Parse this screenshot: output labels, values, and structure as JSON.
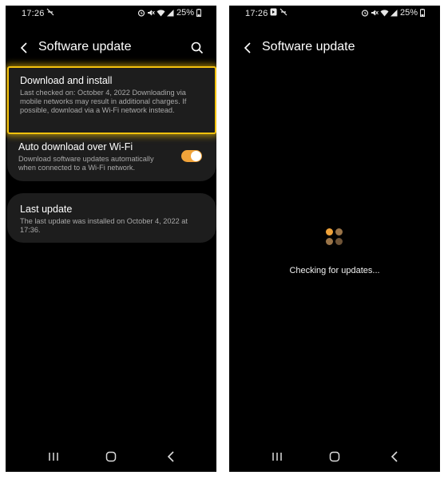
{
  "left": {
    "status": {
      "time": "17:26",
      "battery": "25%"
    },
    "header": {
      "title": "Software update"
    },
    "download_card": {
      "title": "Download and install",
      "subtitle": "Last checked on: October 4, 2022 Downloading via mobile networks may result in additional charges. If possible, download via a Wi-Fi network instead."
    },
    "auto_card": {
      "title": "Auto download over Wi-Fi",
      "subtitle": "Download software updates automatically when connected to a Wi-Fi network.",
      "toggle_on": true
    },
    "last_card": {
      "title": "Last update",
      "subtitle": "The last update was installed on October 4, 2022 at 17:36."
    }
  },
  "right": {
    "status": {
      "time": "17:26",
      "battery": "25%"
    },
    "header": {
      "title": "Software update"
    },
    "checking_text": "Checking for updates..."
  },
  "colors": {
    "accent": "#f0a33a",
    "highlight": "#f4c20d",
    "card_bg": "#1d1d1d",
    "loader_dots": [
      "#f0a33a",
      "#9a7448",
      "#6e5336",
      "#9a7448"
    ]
  }
}
